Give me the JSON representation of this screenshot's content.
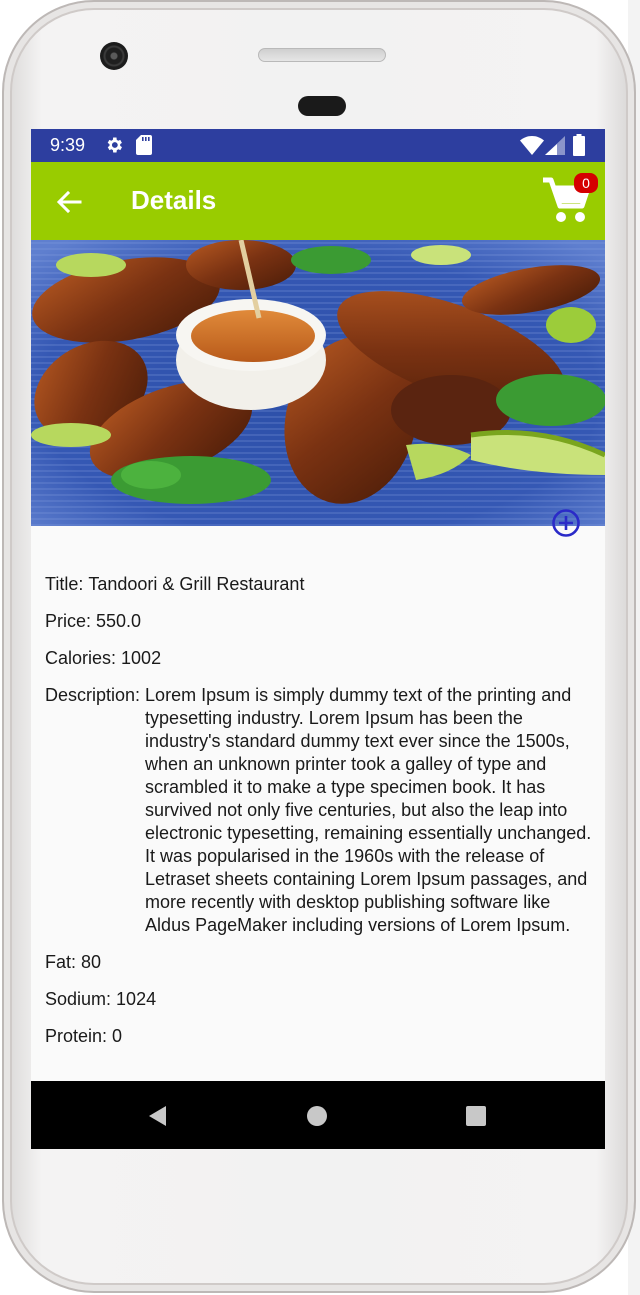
{
  "status_bar": {
    "time": "9:39",
    "icons": [
      "settings-gear-icon",
      "sd-card-icon",
      "wifi-icon",
      "cell-signal-icon",
      "battery-icon"
    ]
  },
  "app_bar": {
    "title": "Details",
    "back_icon": "arrow-left-icon",
    "cart_icon": "shopping-cart-icon",
    "cart_count": "0",
    "color": "#99cc00"
  },
  "status_bar_color": "#2d3e9f",
  "image": {
    "subject": "grilled tandoori chicken drumsticks with dipping sauce, cilantro and lime wedges on a blue plate"
  },
  "add_button_icon": "add-circle-icon",
  "details": {
    "title_label": "Title:",
    "title_value": "Tandoori & Grill Restaurant",
    "price_label": "Price:",
    "price_value": "550.0",
    "calories_label": "Calories:",
    "calories_value": "1002",
    "description_label": "Description:",
    "description_value": "Lorem Ipsum is simply dummy text of the printing and typesetting industry. Lorem Ipsum has been the industry's standard dummy text ever since the 1500s, when an unknown printer took a galley of type and scrambled it to make a type specimen book. It has survived not only five centuries, but also the leap into electronic typesetting, remaining essentially unchanged. It was popularised in the 1960s with the release of Letraset sheets containing Lorem Ipsum passages, and more recently with desktop publishing software like Aldus PageMaker including versions of Lorem Ipsum.",
    "fat_label": "Fat:",
    "fat_value": "80",
    "sodium_label": "Sodium:",
    "sodium_value": "1024",
    "protein_label": "Protein:",
    "protein_value": "0"
  },
  "nav_bar": {
    "icons": [
      "nav-back-icon",
      "nav-home-icon",
      "nav-recents-icon"
    ]
  }
}
